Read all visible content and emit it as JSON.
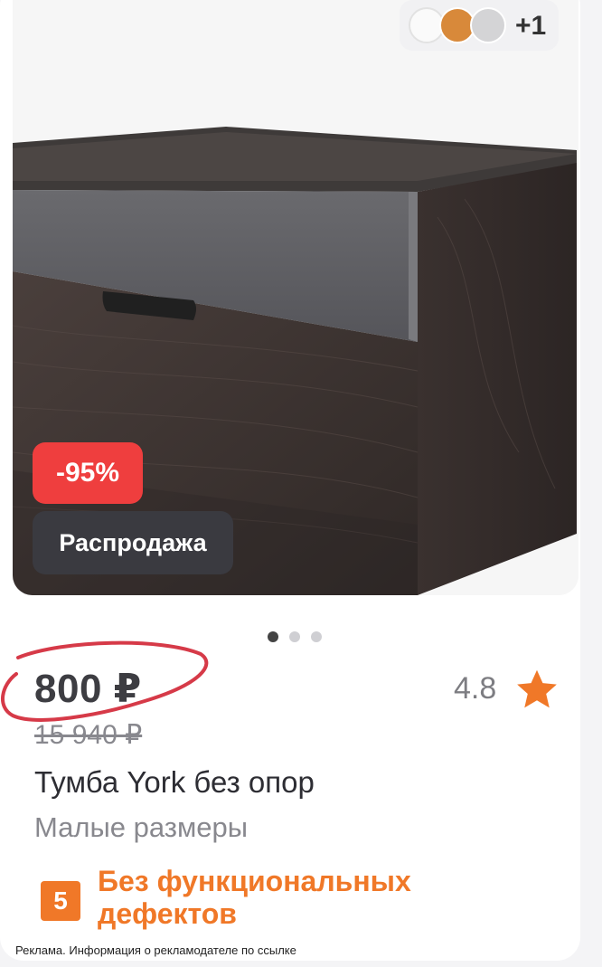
{
  "product": {
    "discount": "-95%",
    "sale_label": "Распродажа",
    "price": "800 ₽",
    "old_price": "15 940 ₽",
    "rating": "4.8",
    "title": "Тумба York без опор",
    "subtitle": "Малые размеры",
    "quality_badge_icon": "5",
    "quality_text": "Без функциональных дефектов"
  },
  "swatches": {
    "colors": [
      "#fafafa",
      "#d8893a",
      "#d4d4d6"
    ],
    "more_label": "+1"
  },
  "carousel": {
    "total": 3,
    "active_index": 0
  },
  "ad_note": "Реклама. Информация о рекламодателе по ссылке",
  "colors": {
    "discount_badge": "#ef3e3e",
    "sale_badge": "#3a3a40",
    "accent_orange": "#f07828",
    "star": "#f07828",
    "annotation_circle": "#d63a48"
  }
}
